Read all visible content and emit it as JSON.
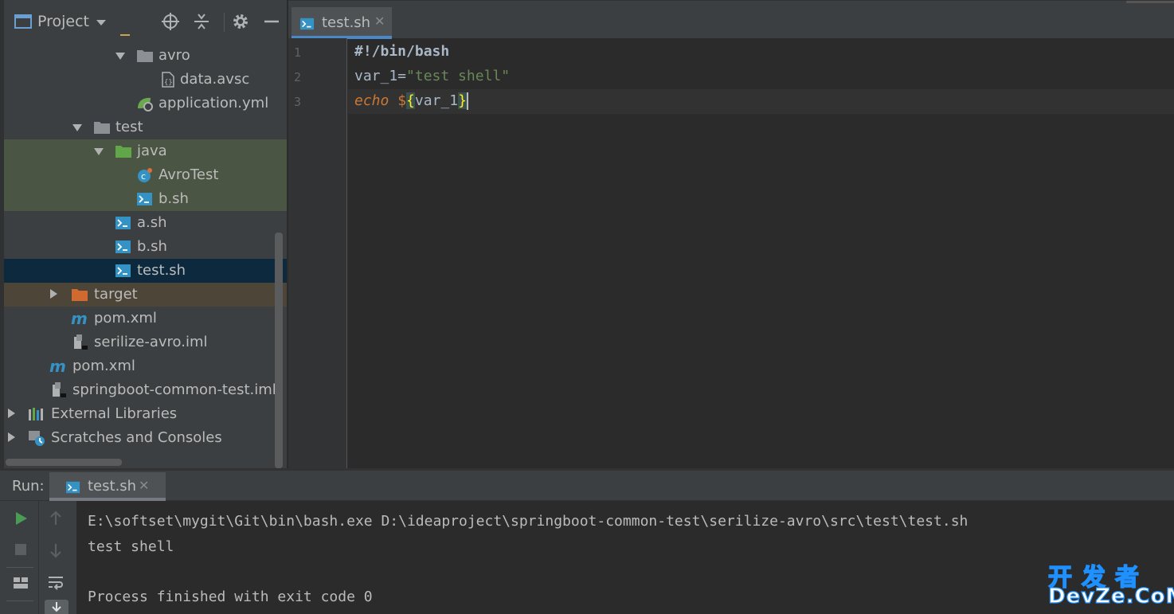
{
  "project_panel": {
    "title": "Project",
    "tree": [
      {
        "label": "",
        "icon": "folder-icon"
      },
      {
        "label": "avro",
        "icon": "folder-icon",
        "expanded": true
      },
      {
        "label": "data.avsc",
        "icon": "avro-schema-icon"
      },
      {
        "label": "application.yml",
        "icon": "spring-config-icon"
      },
      {
        "label": "test",
        "icon": "folder-icon",
        "expanded": true
      },
      {
        "label": "java",
        "icon": "test-source-folder-icon",
        "expanded": true
      },
      {
        "label": "AvroTest",
        "icon": "java-class-icon"
      },
      {
        "label": "b.sh",
        "icon": "shell-script-icon"
      },
      {
        "label": "a.sh",
        "icon": "shell-script-icon"
      },
      {
        "label": "b.sh",
        "icon": "shell-script-icon"
      },
      {
        "label": "test.sh",
        "icon": "shell-script-icon",
        "selected": true
      },
      {
        "label": "target",
        "icon": "excluded-folder-icon",
        "expanded": false
      },
      {
        "label": "pom.xml",
        "icon": "maven-icon"
      },
      {
        "label": "serilize-avro.iml",
        "icon": "module-file-icon"
      },
      {
        "label": "pom.xml",
        "icon": "maven-icon"
      },
      {
        "label": "springboot-common-test.iml",
        "icon": "module-file-icon"
      },
      {
        "label": "External Libraries",
        "icon": "libraries-icon",
        "expanded": false
      },
      {
        "label": "Scratches and Consoles",
        "icon": "scratches-icon",
        "expanded": false
      }
    ]
  },
  "editor": {
    "tab_label": "test.sh",
    "line_numbers": [
      "1",
      "2",
      "3"
    ],
    "lines": {
      "l1": "#!/bin/bash",
      "l2_var": "var_1=",
      "l2_str": "\"test shell\"",
      "l3_echo": "echo",
      "l3_dollar": "$",
      "l3_open": "{",
      "l3_var": "var_1",
      "l3_close": "}"
    }
  },
  "run_panel": {
    "label": "Run:",
    "tab_label": "test.sh",
    "console": [
      "E:\\softset\\mygit\\Git\\bin\\bash.exe D:\\ideaproject\\springboot-common-test\\serilize-avro\\src\\test\\test.sh",
      "test shell",
      "",
      "Process finished with exit code 0"
    ]
  },
  "watermark": {
    "top": "开发者",
    "bottom": "DevZe.CoM"
  },
  "colors": {
    "accent": "#4a88c7",
    "string": "#6a8759",
    "keyword": "#cc7832",
    "run_green": "#499c54",
    "watermark_stroke": "#1e90ff"
  }
}
